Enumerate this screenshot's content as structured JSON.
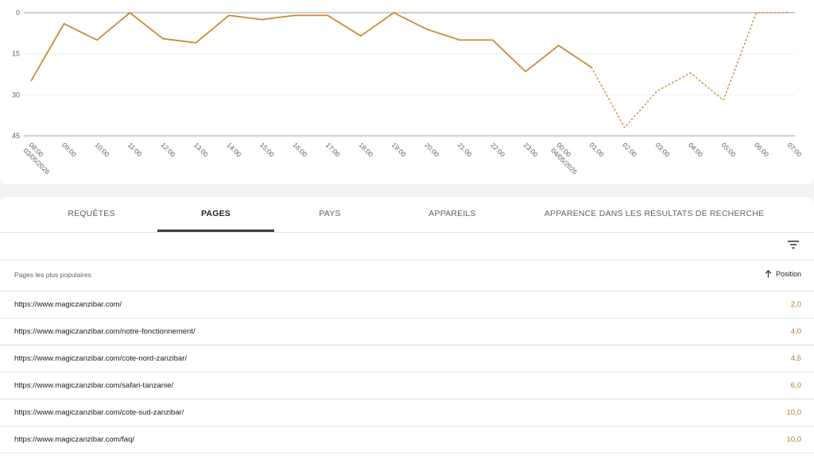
{
  "chart_data": {
    "type": "line",
    "y_ticks": [
      "0",
      "15",
      "30",
      "45"
    ],
    "ylim": [
      0,
      45
    ],
    "y_inverted": true,
    "grid": true,
    "color": "#c98a35",
    "x": [
      "08:00 03/05/2026",
      "09:00",
      "10:00",
      "11:00",
      "12:00",
      "13:00",
      "14:00",
      "15:00",
      "16:00",
      "17:00",
      "18:00",
      "19:00",
      "20:00",
      "21:00",
      "22:00",
      "23:00",
      "00:00 04/05/2026",
      "01:00",
      "02:00",
      "03:00",
      "04:00",
      "05:00",
      "06:00",
      "07:00"
    ],
    "series": [
      {
        "style": "solid",
        "values": [
          25,
          4,
          10,
          0,
          9.5,
          11,
          1,
          2.5,
          1,
          1,
          8.5,
          0,
          6,
          10,
          10,
          21.5,
          12,
          20,
          null,
          null,
          null,
          null,
          null,
          null
        ]
      },
      {
        "style": "dotted",
        "values": [
          null,
          null,
          null,
          null,
          null,
          null,
          null,
          null,
          null,
          null,
          null,
          null,
          null,
          null,
          null,
          null,
          null,
          20,
          42,
          28.5,
          22,
          32,
          0,
          0
        ]
      }
    ]
  },
  "tabs": [
    {
      "label": "REQUÊTES",
      "active": false
    },
    {
      "label": "PAGES",
      "active": true
    },
    {
      "label": "PAYS",
      "active": false
    },
    {
      "label": "APPAREILS",
      "active": false
    },
    {
      "label": "APPARENCE DANS LES RÉSULTATS DE RECHERCHE",
      "active": false
    }
  ],
  "table": {
    "column_left": "Pages les plus populaires",
    "column_right": "Position",
    "sort_icon": "arrow-up-icon",
    "filter_icon": "filter-icon",
    "rows": [
      {
        "url": "https://www.magiczanzibar.com/",
        "position": "2,0"
      },
      {
        "url": "https://www.magiczanzibar.com/notre-fonctionnement/",
        "position": "4,0"
      },
      {
        "url": "https://www.magiczanzibar.com/cote-nord-zanzibar/",
        "position": "4,5"
      },
      {
        "url": "https://www.magiczanzibar.com/safari-tanzanie/",
        "position": "6,0"
      },
      {
        "url": "https://www.magiczanzibar.com/cote-sud-zanzibar/",
        "position": "10,0"
      },
      {
        "url": "https://www.magiczanzibar.com/faq/",
        "position": "10,0"
      }
    ]
  }
}
